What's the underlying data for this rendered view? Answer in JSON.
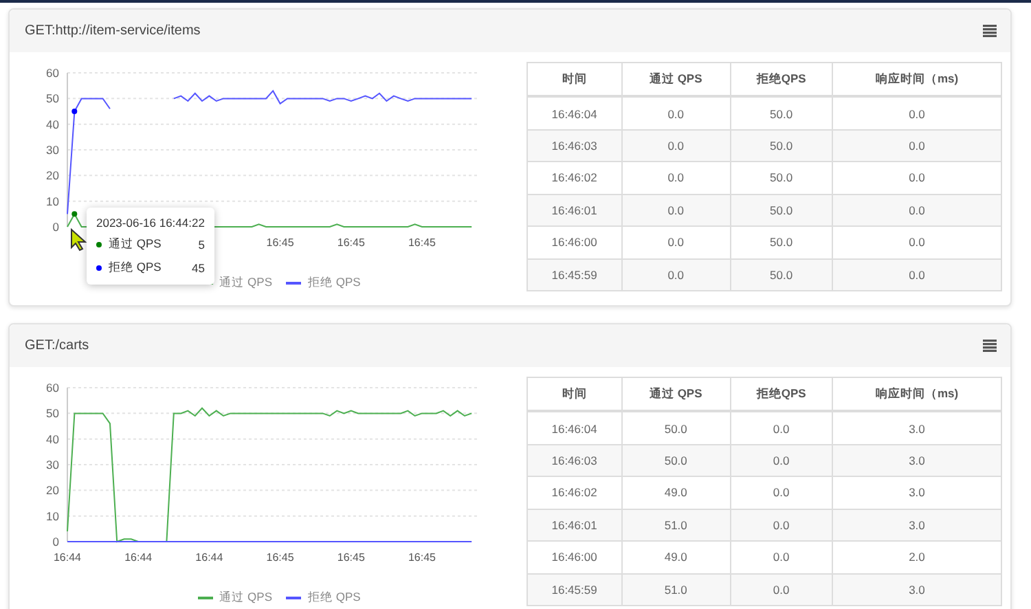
{
  "panels": [
    {
      "title": "GET:http://item-service/items",
      "chart_data": {
        "type": "line",
        "categories": [
          null,
          null,
          null,
          null,
          null,
          null,
          null,
          null,
          null,
          null,
          null,
          null,
          null,
          null,
          null,
          null,
          null,
          null,
          null,
          null,
          null,
          null,
          null,
          null,
          null,
          null,
          null,
          null,
          null,
          null,
          "16:45",
          null,
          null,
          null,
          null,
          null,
          null,
          null,
          null,
          null,
          "16:45",
          null,
          null,
          null,
          null,
          null,
          null,
          null,
          null,
          null,
          "16:45",
          null,
          null,
          null,
          null,
          null,
          null,
          null
        ],
        "ylim": [
          0,
          60
        ],
        "yticks": [
          0,
          10,
          20,
          30,
          40,
          50,
          60
        ],
        "grid": true,
        "series": [
          {
            "name": "通过 QPS",
            "color": "#4caf50",
            "values": [
              0,
              5,
              0,
              0,
              null,
              null,
              null,
              null,
              null,
              null,
              null,
              null,
              null,
              null,
              null,
              null,
              null,
              null,
              null,
              null,
              0,
              0,
              0,
              0,
              0,
              0,
              0,
              1,
              0,
              0,
              0,
              0,
              0,
              0,
              0,
              0,
              0,
              0,
              1,
              0,
              0,
              0,
              0,
              0,
              0,
              0,
              0,
              0,
              0,
              1,
              0,
              0,
              0,
              0,
              0,
              0,
              0,
              0
            ]
          },
          {
            "name": "拒绝 QPS",
            "color": "#5555ff",
            "values": [
              5,
              45,
              50,
              50,
              50,
              50,
              46,
              null,
              null,
              null,
              null,
              null,
              null,
              null,
              null,
              50,
              51,
              49,
              52,
              49,
              51,
              49,
              50,
              50,
              50,
              50,
              50,
              50,
              50,
              53,
              48,
              50,
              50,
              50,
              50,
              50,
              50,
              49,
              50,
              50,
              49,
              50,
              51,
              50,
              52,
              49,
              51,
              50,
              49,
              50,
              50,
              50,
              50,
              50,
              50,
              50,
              50,
              50
            ]
          }
        ]
      },
      "tooltip": {
        "title": "2023-06-16 16:44:22",
        "items": [
          {
            "label": "通过 QPS",
            "value": "5",
            "color": "#008000"
          },
          {
            "label": "拒绝 QPS",
            "value": "45",
            "color": "#0000ff"
          }
        ]
      },
      "table": {
        "columns": [
          "时间",
          "通过 QPS",
          "拒绝QPS",
          "响应时间（ms)"
        ],
        "rows": [
          [
            "16:46:04",
            "0.0",
            "50.0",
            "0.0"
          ],
          [
            "16:46:03",
            "0.0",
            "50.0",
            "0.0"
          ],
          [
            "16:46:02",
            "0.0",
            "50.0",
            "0.0"
          ],
          [
            "16:46:01",
            "0.0",
            "50.0",
            "0.0"
          ],
          [
            "16:46:00",
            "0.0",
            "50.0",
            "0.0"
          ],
          [
            "16:45:59",
            "0.0",
            "50.0",
            "0.0"
          ]
        ]
      }
    },
    {
      "title": "GET:/carts",
      "chart_data": {
        "type": "line",
        "categories": [
          "16:44",
          null,
          null,
          null,
          null,
          null,
          null,
          null,
          null,
          null,
          "16:44",
          null,
          null,
          null,
          null,
          null,
          null,
          null,
          null,
          null,
          "16:44",
          null,
          null,
          null,
          null,
          null,
          null,
          null,
          null,
          null,
          "16:45",
          null,
          null,
          null,
          null,
          null,
          null,
          null,
          null,
          null,
          "16:45",
          null,
          null,
          null,
          null,
          null,
          null,
          null,
          null,
          null,
          "16:45",
          null,
          null,
          null,
          null,
          null,
          null,
          null
        ],
        "ylim": [
          0,
          60
        ],
        "yticks": [
          0,
          10,
          20,
          30,
          40,
          50,
          60
        ],
        "grid": true,
        "series": [
          {
            "name": "通过 QPS",
            "color": "#4caf50",
            "values": [
              4,
              50,
              50,
              50,
              50,
              50,
              46,
              0,
              1,
              1,
              0,
              0,
              0,
              0,
              0,
              50,
              50,
              51,
              49,
              52,
              49,
              51,
              49,
              50,
              50,
              50,
              50,
              50,
              50,
              50,
              50,
              50,
              50,
              50,
              50,
              50,
              50,
              49,
              51,
              50,
              51,
              50,
              50,
              50,
              50,
              50,
              50,
              50,
              51,
              49,
              50,
              50,
              50,
              51,
              49,
              51,
              49,
              50
            ]
          },
          {
            "name": "拒绝 QPS",
            "color": "#5555ff",
            "values": [
              0,
              0,
              0,
              0,
              0,
              0,
              0,
              0,
              0,
              0,
              0,
              0,
              0,
              0,
              0,
              0,
              0,
              0,
              0,
              0,
              0,
              0,
              0,
              0,
              0,
              0,
              0,
              0,
              0,
              0,
              0,
              0,
              0,
              0,
              0,
              0,
              0,
              0,
              0,
              0,
              0,
              0,
              0,
              0,
              0,
              0,
              0,
              0,
              0,
              0,
              0,
              0,
              0,
              0,
              0,
              0,
              0,
              0
            ]
          }
        ]
      },
      "table": {
        "columns": [
          "时间",
          "通过 QPS",
          "拒绝QPS",
          "响应时间（ms)"
        ],
        "rows": [
          [
            "16:46:04",
            "50.0",
            "0.0",
            "3.0"
          ],
          [
            "16:46:03",
            "50.0",
            "0.0",
            "3.0"
          ],
          [
            "16:46:02",
            "49.0",
            "0.0",
            "3.0"
          ],
          [
            "16:46:01",
            "51.0",
            "0.0",
            "3.0"
          ],
          [
            "16:46:00",
            "49.0",
            "0.0",
            "2.0"
          ],
          [
            "16:45:59",
            "51.0",
            "0.0",
            "3.0"
          ]
        ]
      }
    }
  ]
}
